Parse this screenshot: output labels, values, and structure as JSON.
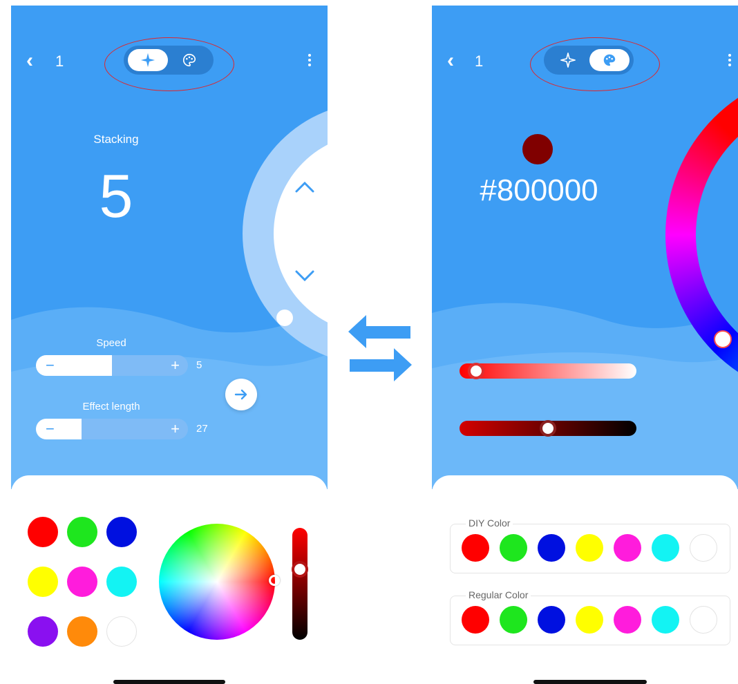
{
  "left_screen": {
    "back_label": "<",
    "page_number": "1",
    "mode_toggle": {
      "active": "effects",
      "icons": [
        "sparkle-icon",
        "palette-icon"
      ]
    },
    "effect_name": "Stacking",
    "effect_value": "5",
    "speed": {
      "label": "Speed",
      "value": "5",
      "fraction": 0.5,
      "minus": "−",
      "plus": "+"
    },
    "effect_length": {
      "label": "Effect length",
      "value": "27",
      "fraction": 0.3,
      "minus": "−",
      "plus": "+"
    },
    "swatches": [
      "#ff0000",
      "#1ee61e",
      "#0010e0",
      "#ffff00",
      "#ff1cdc",
      "#13f3f3",
      "#8a10f0",
      "#ff8a0a",
      "#ffffff"
    ],
    "brightness_fraction": 0.35
  },
  "right_screen": {
    "back_label": "<",
    "page_number": "1",
    "mode_toggle": {
      "active": "color",
      "icons": [
        "sparkle-icon",
        "palette-icon"
      ]
    },
    "current_color": "#800000",
    "hex_value": "#800000",
    "saturation_fraction": 0.05,
    "brightness_fraction": 0.5,
    "diy_color": {
      "title": "DIY Color",
      "swatches": [
        "#ff0000",
        "#1ee61e",
        "#0010e0",
        "#ffff00",
        "#ff1cdc",
        "#13f3f3",
        "#ffffff"
      ]
    },
    "regular_color": {
      "title": "Regular Color",
      "swatches": [
        "#ff0000",
        "#1ee61e",
        "#0010e0",
        "#ffff00",
        "#ff1cdc",
        "#13f3f3",
        "#ffffff"
      ]
    }
  },
  "colors": {
    "primary_blue": "#3d9df4",
    "highlight_ring": "#e0252a"
  }
}
